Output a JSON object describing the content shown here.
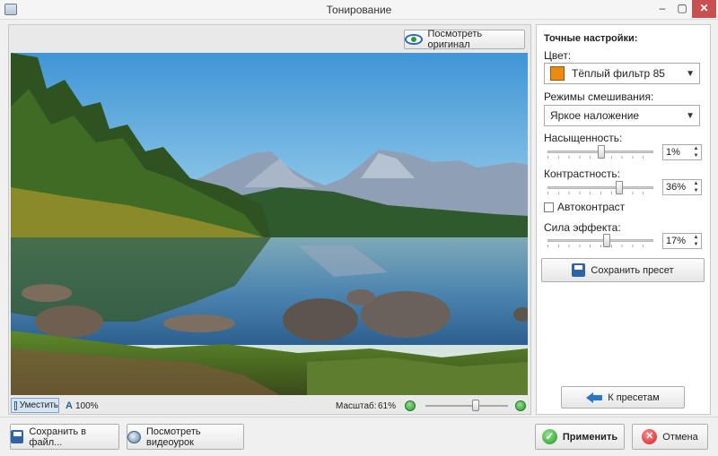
{
  "window": {
    "title": "Тонирование",
    "minimize": "–",
    "maximize": "▢",
    "close": "✕"
  },
  "preview": {
    "view_original_label": "Посмотреть оригинал",
    "fit_label": "Уместить",
    "original_size_label": "100%",
    "zoom_label": "Масштаб:",
    "zoom_value": "61%",
    "zoom_level": 0.61
  },
  "settings": {
    "title": "Точные настройки:",
    "color_label": "Цвет:",
    "color_value": "Тёплый фильтр 85",
    "color_swatch": "#ec8a12",
    "blend_label": "Режимы смешивания:",
    "blend_value": "Яркое наложение",
    "saturation_label": "Насыщенность:",
    "saturation_value": "1%",
    "saturation_level": 0.51,
    "contrast_label": "Контрастность:",
    "contrast_value": "36%",
    "contrast_level": 0.68,
    "autocontrast_label": "Автоконтраст",
    "autocontrast_checked": false,
    "strength_label": "Сила эффекта:",
    "strength_value": "17%",
    "strength_level": 0.56,
    "save_preset_label": "Сохранить пресет",
    "back_to_presets_label": "К пресетам"
  },
  "footer": {
    "save_to_file_label": "Сохранить в файл...",
    "watch_video_label": "Посмотреть видеоурок",
    "apply_label": "Применить",
    "cancel_label": "Отмена"
  },
  "icons": [
    "app-icon",
    "eye-icon",
    "fit-icon",
    "original-size-icon",
    "zoom-minus-icon",
    "zoom-plus-icon",
    "save-icon",
    "arrow-left-icon",
    "video-icon",
    "check-icon",
    "close-icon"
  ]
}
